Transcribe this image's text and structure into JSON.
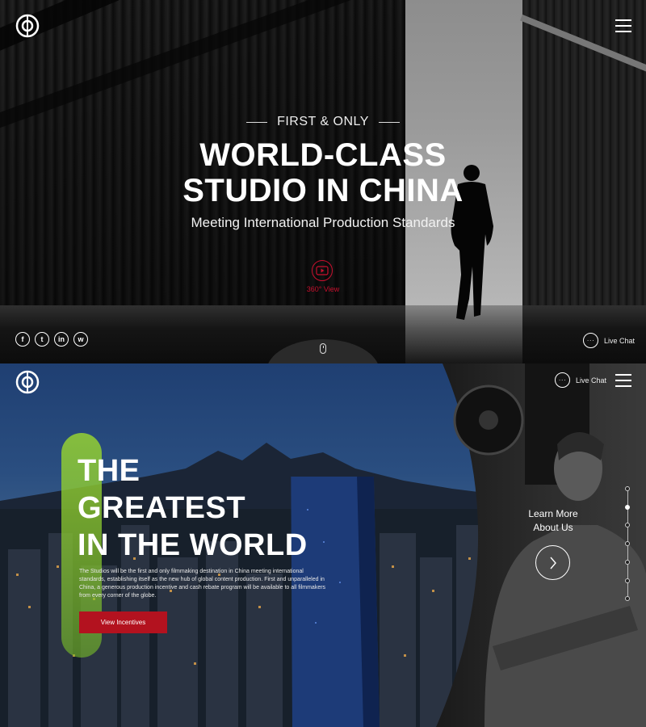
{
  "hero1": {
    "eyebrow": "FIRST & ONLY",
    "headline_line1": "WORLD-CLASS",
    "headline_line2": "STUDIO IN CHINA",
    "subline": "Meeting International Production Standards",
    "play_label": "360° View",
    "socials": [
      {
        "icon": "facebook-icon",
        "glyph": "f"
      },
      {
        "icon": "twitter-icon",
        "glyph": "t"
      },
      {
        "icon": "linkedin-icon",
        "glyph": "in"
      },
      {
        "icon": "weibo-icon",
        "glyph": "w"
      }
    ],
    "live_chat": "Live Chat",
    "chat_glyph": "···"
  },
  "hero2": {
    "headline_line1": "THE",
    "headline_line2": "GREATEST",
    "headline_line3": "IN THE WORLD",
    "paragraph": "The Studios will be the first and only filmmaking destination in China meeting international standards, establishing itself as the new hub of global content production. First and unparalleled in China, a generous production incentive and cash rebate program will be available to all filmmakers from every corner of the globe.",
    "cta_label": "View Incentives",
    "live_chat": "Live Chat",
    "chat_glyph": "···",
    "learn_line1": "Learn More",
    "learn_line2": "About Us",
    "nav_dots": 7,
    "active_dot": 1
  },
  "colors": {
    "accent_red": "#c8102e",
    "cta_red": "#b3121f",
    "pill_green": "#8fcd3a"
  }
}
